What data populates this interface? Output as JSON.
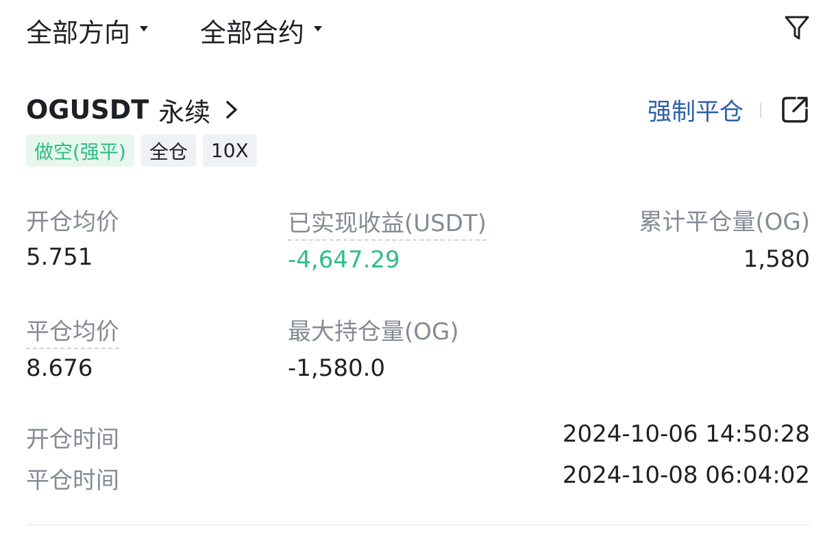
{
  "filters": {
    "direction_label": "全部方向",
    "contract_label": "全部合约"
  },
  "position": {
    "symbol": "OGUSDT",
    "symbol_suffix": "永续",
    "force_close_label": "强制平仓",
    "tags": {
      "direction": "做空(强平)",
      "margin_mode": "全仓",
      "leverage": "10X"
    }
  },
  "stats": {
    "open_avg_price": {
      "label": "开仓均价",
      "value": "5.751"
    },
    "realized_pnl": {
      "label": "已实现收益(USDT)",
      "value": "-4,647.29"
    },
    "closed_volume": {
      "label": "累计平仓量(OG)",
      "value": "1,580"
    },
    "close_avg_price": {
      "label": "平仓均价",
      "value": "8.676"
    },
    "max_position": {
      "label": "最大持仓量(OG)",
      "value": "-1,580.0"
    }
  },
  "times": {
    "open_time": {
      "label": "开仓时间",
      "value": "2024-10-06 14:50:28"
    },
    "close_time": {
      "label": "平仓时间",
      "value": "2024-10-08 06:04:02"
    }
  },
  "colors": {
    "text_primary": "#1e2026",
    "text_secondary": "#858a94",
    "profit_green": "#2ebd85",
    "link_blue": "#2e5fa6",
    "tag_green_bg": "#e7f6ee",
    "tag_gray_bg": "#eff1f4"
  },
  "icons": {
    "filter": "funnel-icon",
    "share": "external-link-icon",
    "chevron": "chevron-right-icon",
    "caret": "caret-down-icon"
  }
}
